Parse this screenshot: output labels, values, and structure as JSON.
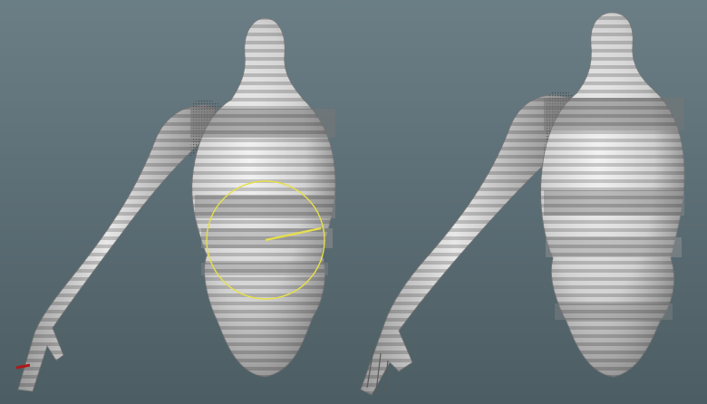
{
  "app": {
    "name": "3D viewport",
    "panel": "perspective-viewport"
  },
  "scene": {
    "background_top": "#6b7e86",
    "background_bottom": "#4c5d63",
    "body_light": "#f0f0f0",
    "body_mid": "#c8c8c8",
    "body_dark": "#8a8a8a",
    "band_dark": "#7a7a7a",
    "stripe_color": "#a9a9a9",
    "manipulator_color": "#e6e04a",
    "selection_color": "#b01818"
  },
  "models": [
    {
      "name": "left-mannequin",
      "state": "selected",
      "tool": "rotate-manipulator"
    },
    {
      "name": "right-mannequin",
      "state": "idle"
    }
  ]
}
